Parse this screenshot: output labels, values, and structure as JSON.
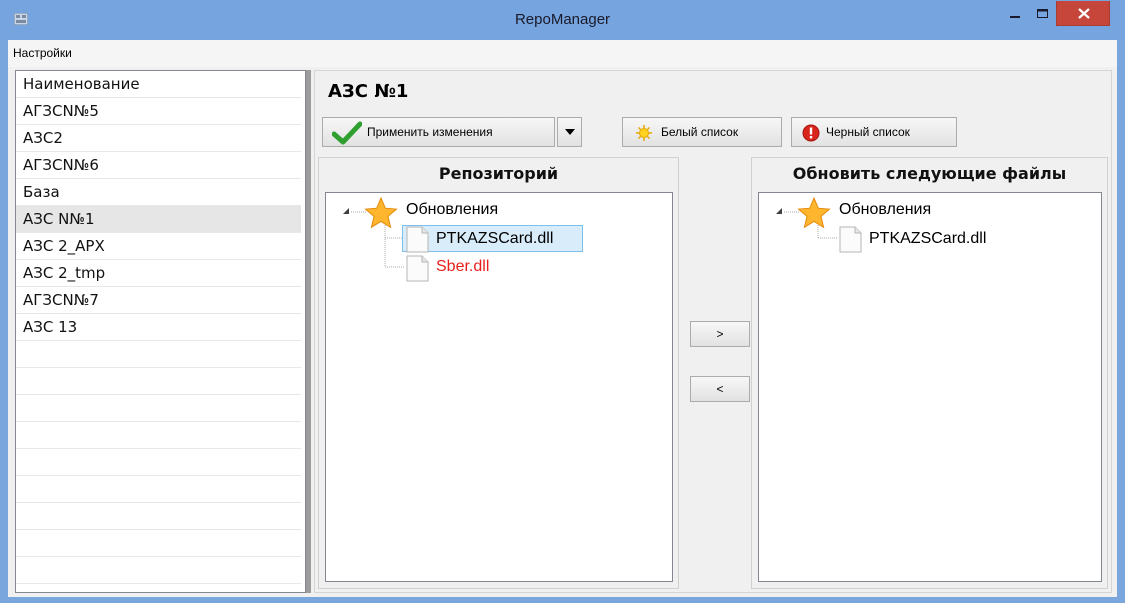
{
  "window": {
    "title": "RepoManager"
  },
  "menu": {
    "settings": "Настройки"
  },
  "left_list": {
    "items": [
      {
        "label": "Наименование",
        "selected": false
      },
      {
        "label": "АГЗСN№5",
        "selected": false
      },
      {
        "label": "АЗС2",
        "selected": false
      },
      {
        "label": "АГЗСN№6",
        "selected": false
      },
      {
        "label": "База",
        "selected": false
      },
      {
        "label": "АЗС N№1",
        "selected": true
      },
      {
        "label": "АЗС 2_АРХ",
        "selected": false
      },
      {
        "label": "АЗС 2_tmp",
        "selected": false
      },
      {
        "label": "АГЗСN№7",
        "selected": false
      },
      {
        "label": "АЗС 13",
        "selected": false
      }
    ]
  },
  "main": {
    "title": "АЗС №1",
    "apply_label": "Применить изменения",
    "white_list_label": "Белый список",
    "black_list_label": "Черный список",
    "move_right_label": ">",
    "move_left_label": "<"
  },
  "repository": {
    "title": "Репозиторий",
    "root": "Обновления",
    "files": [
      {
        "name": "PTKAZSCard.dll",
        "selected": true,
        "color": "#000000"
      },
      {
        "name": "Sber.dll",
        "selected": false,
        "color": "#e8201c"
      }
    ]
  },
  "update_files": {
    "title": "Обновить следующие файлы",
    "root": "Обновления",
    "files": [
      {
        "name": "PTKAZSCard.dll"
      }
    ]
  },
  "colors": {
    "titlebar": "#75a4de",
    "close_button": "#c7463c",
    "selection": "#d8ecfa",
    "error_text": "#e8201c"
  }
}
